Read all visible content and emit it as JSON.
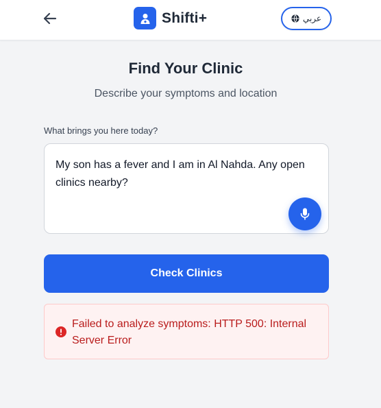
{
  "header": {
    "back_icon": "arrow-left-icon",
    "logo_icon": "doctor-icon",
    "brand_name": "Shifti+",
    "language_button": {
      "label": "عربي",
      "icon": "globe-icon"
    }
  },
  "main": {
    "title": "Find Your Clinic",
    "subtitle": "Describe your symptoms and location",
    "symptom_field": {
      "label": "What brings you here today?",
      "value": "My son has a fever and I am in Al Nahda. Any open clinics nearby?",
      "mic_icon": "microphone-icon"
    },
    "submit_button": {
      "label": "Check Clinics"
    },
    "error": {
      "icon": "error-circle-icon",
      "message": "Failed to analyze symptoms: HTTP 500: Internal Server Error"
    }
  },
  "colors": {
    "primary": "#2563eb",
    "background": "#f3f4f6",
    "error_text": "#b91c1c",
    "error_background": "#fef2f2"
  }
}
